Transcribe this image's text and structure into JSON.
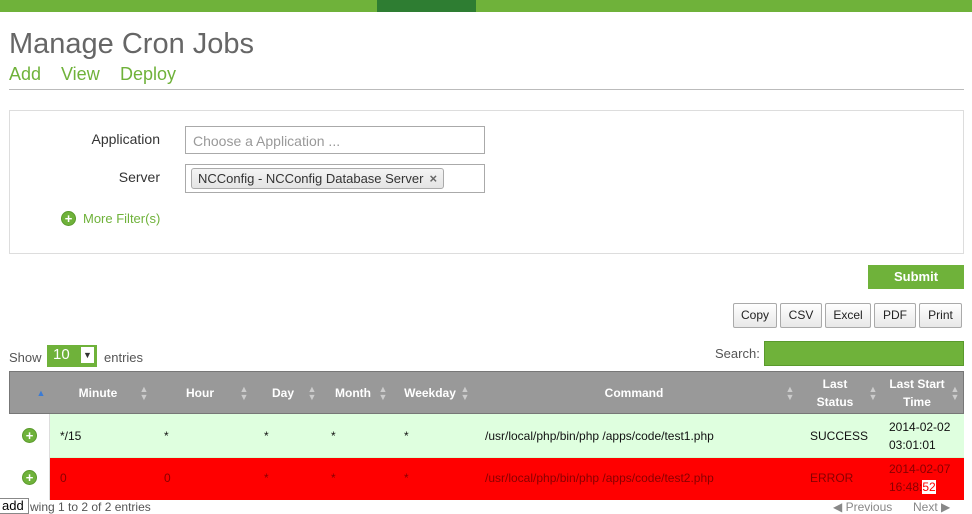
{
  "page": {
    "title": "Manage Cron Jobs"
  },
  "nav": {
    "add": "Add",
    "view": "View",
    "deploy": "Deploy"
  },
  "filters": {
    "application_label": "Application",
    "application_placeholder": "Choose a Application ...",
    "server_label": "Server",
    "server_selected": "NCConfig - NCConfig Database Server",
    "server_remove": "×",
    "more_filters": "More Filter(s)"
  },
  "submit_label": "Submit",
  "export_buttons": {
    "copy": "Copy",
    "csv": "CSV",
    "excel": "Excel",
    "pdf": "PDF",
    "print": "Print"
  },
  "table_controls": {
    "show": "Show",
    "length": "10",
    "entries": "entries",
    "search": "Search:"
  },
  "table": {
    "columns": {
      "minute": "Minute",
      "hour": "Hour",
      "day": "Day",
      "month": "Month",
      "weekday": "Weekday",
      "command": "Command",
      "last_status_1": "Last",
      "last_status_2": "Status",
      "last_start_1": "Last Start",
      "last_start_2": "Time"
    },
    "rows": [
      {
        "minute": "*/15",
        "hour": "*",
        "day": "*",
        "month": "*",
        "weekday": "*",
        "command": "/usr/local/php/bin/php /apps/code/test1.php",
        "status": "SUCCESS",
        "time_line1": "2014-02-02",
        "time_line2": "03:01:01"
      },
      {
        "minute": "0",
        "hour": "0",
        "day": "*",
        "month": "*",
        "weekday": "*",
        "command": "/usr/local/php/bin/php /apps/code/test2.php",
        "status": "ERROR",
        "time_line1": "2014-02-07",
        "time_line2_a": "16:48:",
        "time_line2_b": "52"
      }
    ]
  },
  "footer": {
    "info": "wing 1 to 2 of 2 entries",
    "tooltip": "add",
    "previous": "Previous",
    "next": "Next"
  },
  "colors": {
    "accent": "#6fb23a",
    "success_row": "#dfffdf",
    "error_row": "#ff0000"
  },
  "icons": [
    "plus-circle-icon",
    "sort-icon",
    "sort-asc-icon",
    "prev-arrow-icon",
    "next-arrow-icon",
    "remove-icon"
  ]
}
